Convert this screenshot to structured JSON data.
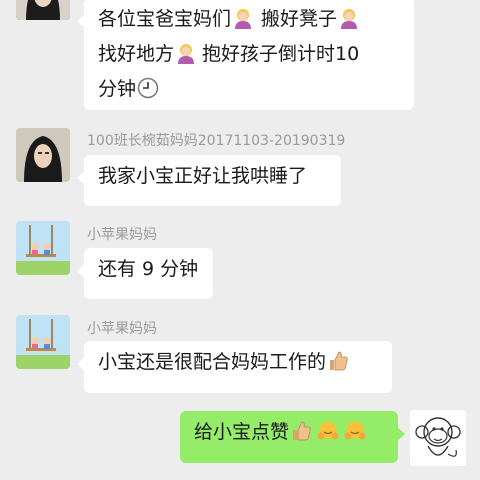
{
  "messages": [
    {
      "sender": "",
      "lines": [
        "各位宝爸宝妈们",
        "搬好凳子",
        "找好地方",
        "抱好孩子倒计时10",
        "分钟"
      ]
    },
    {
      "sender": "100班长椀茹妈妈20171103-20190319",
      "text": "我家小宝正好让我哄睡了"
    },
    {
      "sender": "小苹果妈妈",
      "text": "还有 9 分钟"
    },
    {
      "sender": "小苹果妈妈",
      "text": "小宝还是很配合妈妈工作的"
    },
    {
      "sender": "self",
      "text": "给小宝点赞"
    }
  ],
  "colors": {
    "background": "#ededed",
    "bubble_incoming": "#ffffff",
    "bubble_outgoing": "#95ec69"
  },
  "icons": [
    "woman-tipping-hand-emoji",
    "clock-emoji",
    "thumbs-up-emoji",
    "hugging-face-emoji",
    "monkey-avatar",
    "swing-kids-avatar",
    "woman-photo-avatar"
  ]
}
